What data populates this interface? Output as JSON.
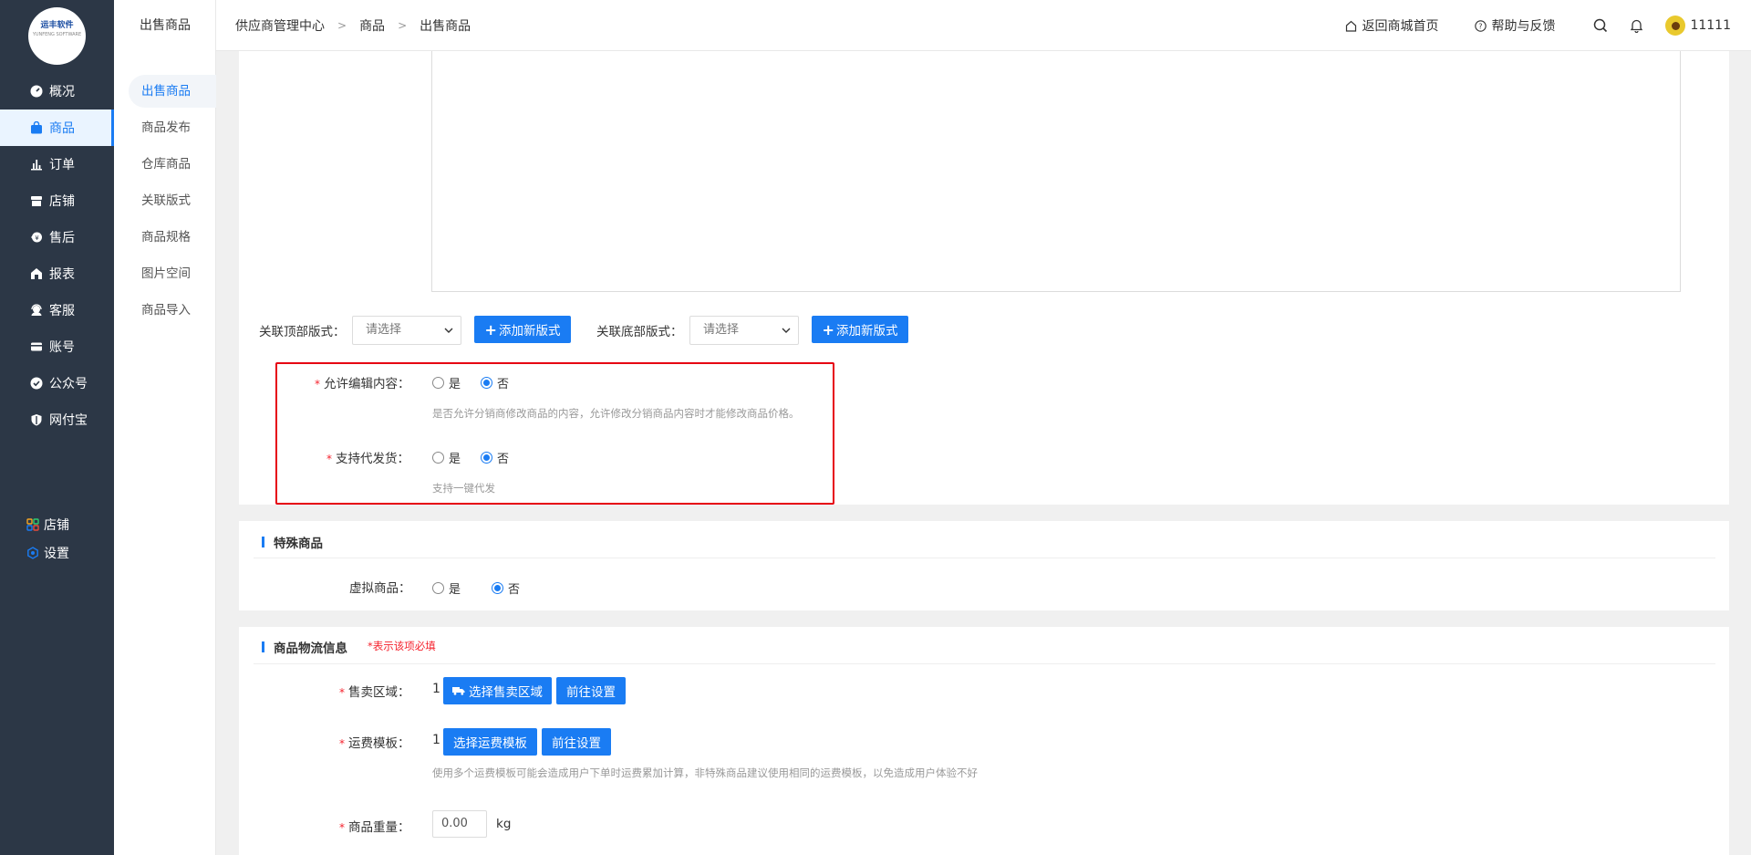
{
  "logo": {
    "text": "运丰软件",
    "subtext": "YUNFENG SOFTWARE"
  },
  "nav": {
    "items": [
      {
        "label": "概况",
        "icon": "dashboard-icon"
      },
      {
        "label": "商品",
        "icon": "bag-icon"
      },
      {
        "label": "订单",
        "icon": "bar-chart-icon"
      },
      {
        "label": "店铺",
        "icon": "store-icon"
      },
      {
        "label": "售后",
        "icon": "aftersale-icon"
      },
      {
        "label": "报表",
        "icon": "report-icon"
      },
      {
        "label": "客服",
        "icon": "headset-icon"
      },
      {
        "label": "账号",
        "icon": "card-icon"
      },
      {
        "label": "公众号",
        "icon": "check-badge-icon"
      },
      {
        "label": "网付宝",
        "icon": "shield-icon"
      }
    ],
    "active": "商品",
    "bottom": [
      {
        "label": "店铺",
        "icon": "grid-icon"
      },
      {
        "label": "设置",
        "icon": "settings-icon"
      }
    ]
  },
  "subnav": {
    "title": "出售商品",
    "items": [
      "出售商品",
      "商品发布",
      "仓库商品",
      "关联版式",
      "商品规格",
      "图片空间",
      "商品导入"
    ],
    "active": "出售商品"
  },
  "header": {
    "breadcrumb": [
      "供应商管理中心",
      "商品",
      "出售商品"
    ],
    "home_link": "返回商城首页",
    "help_link": "帮助与反馈",
    "username": "11111"
  },
  "layout_links": {
    "top_label": "关联顶部版式：",
    "top_placeholder": "请选择",
    "bottom_label": "关联底部版式：",
    "bottom_placeholder": "请选择",
    "add_button": "添加新版式"
  },
  "distribution": {
    "allow_edit": {
      "label": "允许编辑内容：",
      "options": [
        "是",
        "否"
      ],
      "selected": "否",
      "hint": "是否允许分销商修改商品的内容，允许修改分销商品内容时才能修改商品价格。"
    },
    "dropship": {
      "label": "支持代发货：",
      "options": [
        "是",
        "否"
      ],
      "selected": "否",
      "hint": "支持一键代发"
    }
  },
  "special": {
    "title": "特殊商品",
    "virtual": {
      "label": "虚拟商品：",
      "options": [
        "是",
        "否"
      ],
      "selected": "否"
    }
  },
  "logistics": {
    "title": "商品物流信息",
    "required_note": "*表示该项必填",
    "sale_area": {
      "label": "售卖区域：",
      "count": "1",
      "select_button": "选择售卖区域",
      "goto_button": "前往设置"
    },
    "freight": {
      "label": "运费模板：",
      "count": "1",
      "select_button": "选择运费模板",
      "goto_button": "前往设置",
      "hint": "使用多个运费模板可能会造成用户下单时运费累加计算，非特殊商品建议使用相同的运费模板，以免造成用户体验不好"
    },
    "weight": {
      "label": "商品重量：",
      "value": "0.00",
      "unit": "kg"
    }
  },
  "colors": {
    "accent": "#1a7cf3",
    "nav_bg": "#2c3746",
    "highlight_border": "#e60012"
  }
}
